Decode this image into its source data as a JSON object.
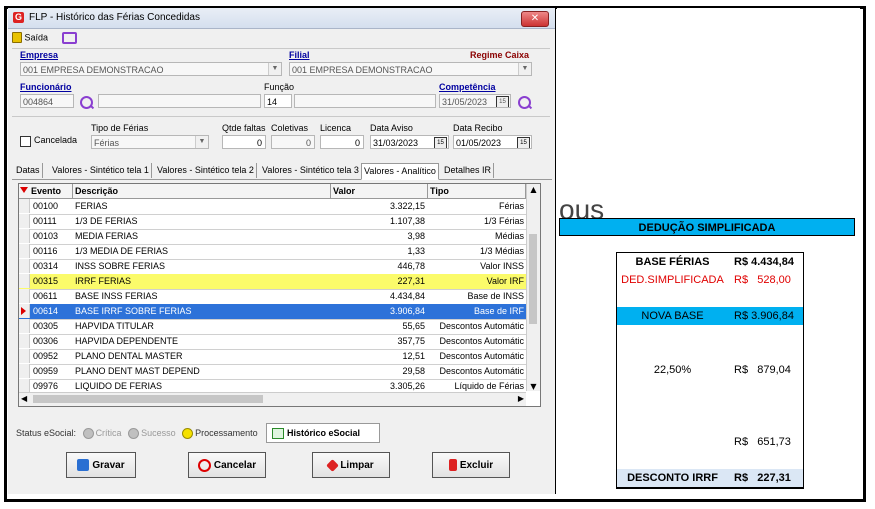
{
  "window": {
    "title": "FLP - Histórico das Férias Concedidas",
    "close_label": "✕",
    "saida_label": "Saída"
  },
  "form": {
    "empresa_label": "Empresa",
    "empresa_value": "001 EMPRESA DEMONSTRACAO",
    "filial_label": "Filial",
    "filial_value": "001 EMPRESA DEMONSTRACAO",
    "regime_label": "Regime Caixa",
    "funcionario_label": "Funcionário",
    "funcionario_value": "004864",
    "funcao_label": "Função",
    "funcao_value": "14",
    "competencia_label": "Competência",
    "competencia_value": "31/05/2023",
    "cancelada_label": "Cancelada",
    "tipo_ferias_label": "Tipo de Férias",
    "tipo_ferias_value": "Férias",
    "qtde_faltas_label": "Qtde faltas",
    "qtde_faltas_value": "0",
    "coletivas_label": "Coletivas",
    "coletivas_value": "0",
    "licenca_label": "Licenca",
    "licenca_value": "0",
    "data_aviso_label": "Data Aviso",
    "data_aviso_value": "31/03/2023",
    "data_recibo_label": "Data Recibo",
    "data_recibo_value": "01/05/2023"
  },
  "tabs": [
    "Datas",
    "Valores - Sintético tela 1",
    "Valores - Sintético tela 2",
    "Valores - Sintético tela 3",
    "Valores - Analítico",
    "Detalhes IR"
  ],
  "grid": {
    "headers": [
      "Evento",
      "Descrição",
      "Valor",
      "Tipo"
    ],
    "rows": [
      {
        "evento": "00100",
        "descricao": "FERIAS",
        "valor": "3.322,15",
        "tipo": "Férias"
      },
      {
        "evento": "00111",
        "descricao": "1/3 DE FERIAS",
        "valor": "1.107,38",
        "tipo": "1/3 Férias"
      },
      {
        "evento": "00103",
        "descricao": "MEDIA FERIAS",
        "valor": "3,98",
        "tipo": "Médias"
      },
      {
        "evento": "00116",
        "descricao": "1/3 MEDIA DE FERIAS",
        "valor": "1,33",
        "tipo": "1/3 Médias"
      },
      {
        "evento": "00314",
        "descricao": "INSS SOBRE FERIAS",
        "valor": "446,78",
        "tipo": "Valor INSS"
      },
      {
        "evento": "00315",
        "descricao": "IRRF FERIAS",
        "valor": "227,31",
        "tipo": "Valor IRF"
      },
      {
        "evento": "00611",
        "descricao": "BASE INSS FERIAS",
        "valor": "4.434,84",
        "tipo": "Base de INSS"
      },
      {
        "evento": "00614",
        "descricao": "BASE IRRF SOBRE FERIAS",
        "valor": "3.906,84",
        "tipo": "Base de IRF"
      },
      {
        "evento": "00305",
        "descricao": "HAPVIDA TITULAR",
        "valor": "55,65",
        "tipo": "Descontos Automátic"
      },
      {
        "evento": "00306",
        "descricao": "HAPVIDA DEPENDENTE",
        "valor": "357,75",
        "tipo": "Descontos Automátic"
      },
      {
        "evento": "00952",
        "descricao": "PLANO DENTAL MASTER",
        "valor": "12,51",
        "tipo": "Descontos Automátic"
      },
      {
        "evento": "00959",
        "descricao": "PLANO DENT MAST DEPEND",
        "valor": "29,58",
        "tipo": "Descontos Automátic"
      },
      {
        "evento": "09976",
        "descricao": "LIQUIDO DE FERIAS",
        "valor": "3.305,26",
        "tipo": "Líquido de Férias"
      }
    ]
  },
  "status": {
    "label": "Status eSocial:",
    "critica": "Crítica",
    "sucesso": "Sucesso",
    "processamento": "Processamento",
    "historico_button": "Histórico eSocial"
  },
  "buttons": {
    "gravar": "Gravar",
    "cancelar": "Cancelar",
    "limpar": "Limpar",
    "excluir": "Excluir"
  },
  "sheet": {
    "partial_text": "ous",
    "title": "DEDUÇÃO SIMPLIFICADA",
    "rows": [
      {
        "label": "BASE FÉRIAS",
        "value": "R$ 4.434,84"
      },
      {
        "label": "DED.SIMPLIFICADA",
        "value": "R$   528,00"
      },
      {
        "label": "",
        "value": ""
      },
      {
        "label": "NOVA BASE",
        "value": "R$ 3.906,84"
      },
      {
        "label": "",
        "value": ""
      },
      {
        "label": "",
        "value": ""
      },
      {
        "label": "22,50%",
        "value": "R$   879,04"
      },
      {
        "label": "",
        "value": ""
      },
      {
        "label": "",
        "value": ""
      },
      {
        "label": "",
        "value": ""
      },
      {
        "label": "",
        "value": "R$   651,73"
      },
      {
        "label": "",
        "value": ""
      },
      {
        "label": "DESCONTO IRRF",
        "value": "R$   227,31"
      }
    ]
  },
  "colors": {
    "accent_blue": "#00b0f0",
    "selected_row": "#2d72d9",
    "highlight_row": "#fbfb6a",
    "red_text": "#e00000"
  }
}
